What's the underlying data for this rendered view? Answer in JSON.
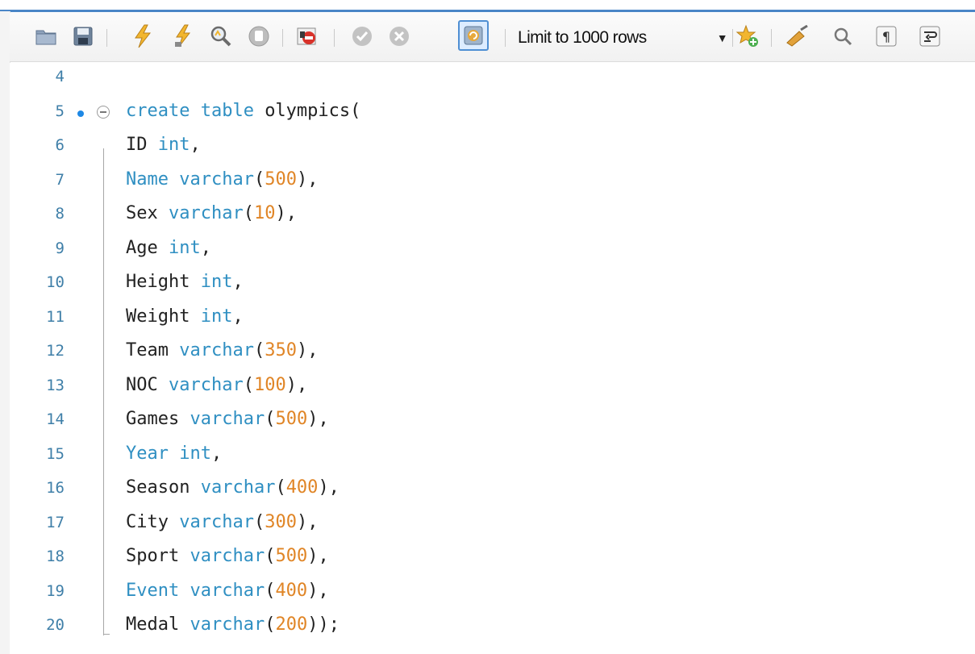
{
  "toolbar": {
    "icons": [
      "open-file-icon",
      "save-icon",
      "execute-icon",
      "execute-current-icon",
      "explain-icon",
      "stop-icon",
      "toggle-error-icon",
      "commit-icon",
      "rollback-icon",
      "autocommit-icon",
      "snippet-star-icon",
      "beautify-icon",
      "find-icon",
      "invisible-chars-icon",
      "wrap-lines-icon"
    ],
    "limit_rows": "Limit to 1000 rows"
  },
  "editor": {
    "lines": [
      {
        "num": "4",
        "segments": []
      },
      {
        "num": "5",
        "segments": [
          {
            "t": "create table ",
            "c": "kw"
          },
          {
            "t": "olympics(",
            "c": ""
          }
        ]
      },
      {
        "num": "6",
        "segments": [
          {
            "t": "ID ",
            "c": ""
          },
          {
            "t": "int",
            "c": "kw"
          },
          {
            "t": ",",
            "c": ""
          }
        ]
      },
      {
        "num": "7",
        "segments": [
          {
            "t": "Name varchar",
            "c": "kw"
          },
          {
            "t": "(",
            "c": ""
          },
          {
            "t": "500",
            "c": "num"
          },
          {
            "t": "),",
            "c": ""
          }
        ]
      },
      {
        "num": "8",
        "segments": [
          {
            "t": "Sex ",
            "c": ""
          },
          {
            "t": "varchar",
            "c": "kw"
          },
          {
            "t": "(",
            "c": ""
          },
          {
            "t": "10",
            "c": "num"
          },
          {
            "t": "),",
            "c": ""
          }
        ]
      },
      {
        "num": "9",
        "segments": [
          {
            "t": "Age ",
            "c": ""
          },
          {
            "t": "int",
            "c": "kw"
          },
          {
            "t": ",",
            "c": ""
          }
        ]
      },
      {
        "num": "10",
        "segments": [
          {
            "t": "Height ",
            "c": ""
          },
          {
            "t": "int",
            "c": "kw"
          },
          {
            "t": ",",
            "c": ""
          }
        ]
      },
      {
        "num": "11",
        "segments": [
          {
            "t": "Weight ",
            "c": ""
          },
          {
            "t": "int",
            "c": "kw"
          },
          {
            "t": ",",
            "c": ""
          }
        ]
      },
      {
        "num": "12",
        "segments": [
          {
            "t": "Team ",
            "c": ""
          },
          {
            "t": "varchar",
            "c": "kw"
          },
          {
            "t": "(",
            "c": ""
          },
          {
            "t": "350",
            "c": "num"
          },
          {
            "t": "),",
            "c": ""
          }
        ]
      },
      {
        "num": "13",
        "segments": [
          {
            "t": "NOC ",
            "c": ""
          },
          {
            "t": "varchar",
            "c": "kw"
          },
          {
            "t": "(",
            "c": ""
          },
          {
            "t": "100",
            "c": "num"
          },
          {
            "t": "),",
            "c": ""
          }
        ]
      },
      {
        "num": "14",
        "segments": [
          {
            "t": "Games ",
            "c": ""
          },
          {
            "t": "varchar",
            "c": "kw"
          },
          {
            "t": "(",
            "c": ""
          },
          {
            "t": "500",
            "c": "num"
          },
          {
            "t": "),",
            "c": ""
          }
        ]
      },
      {
        "num": "15",
        "segments": [
          {
            "t": "Year int",
            "c": "kw"
          },
          {
            "t": ",",
            "c": ""
          }
        ]
      },
      {
        "num": "16",
        "segments": [
          {
            "t": "Season ",
            "c": ""
          },
          {
            "t": "varchar",
            "c": "kw"
          },
          {
            "t": "(",
            "c": ""
          },
          {
            "t": "400",
            "c": "num"
          },
          {
            "t": "),",
            "c": ""
          }
        ]
      },
      {
        "num": "17",
        "segments": [
          {
            "t": "City ",
            "c": ""
          },
          {
            "t": "varchar",
            "c": "kw"
          },
          {
            "t": "(",
            "c": ""
          },
          {
            "t": "300",
            "c": "num"
          },
          {
            "t": "),",
            "c": ""
          }
        ]
      },
      {
        "num": "18",
        "segments": [
          {
            "t": "Sport ",
            "c": ""
          },
          {
            "t": "varchar",
            "c": "kw"
          },
          {
            "t": "(",
            "c": ""
          },
          {
            "t": "500",
            "c": "num"
          },
          {
            "t": "),",
            "c": ""
          }
        ]
      },
      {
        "num": "19",
        "segments": [
          {
            "t": "Event varchar",
            "c": "kw"
          },
          {
            "t": "(",
            "c": ""
          },
          {
            "t": "400",
            "c": "num"
          },
          {
            "t": "),",
            "c": ""
          }
        ]
      },
      {
        "num": "20",
        "segments": [
          {
            "t": "Medal ",
            "c": ""
          },
          {
            "t": "varchar",
            "c": "kw"
          },
          {
            "t": "(",
            "c": ""
          },
          {
            "t": "200",
            "c": "num"
          },
          {
            "t": "));",
            "c": ""
          }
        ]
      }
    ]
  }
}
